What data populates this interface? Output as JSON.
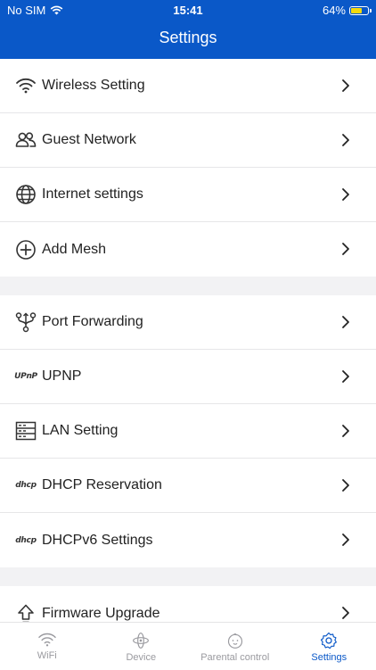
{
  "status_bar": {
    "carrier": "No SIM",
    "time": "15:41",
    "battery": "64%",
    "battery_level": 0.64
  },
  "nav": {
    "title": "Settings"
  },
  "groups": [
    {
      "items": [
        {
          "label": "Wireless Setting",
          "icon": "wifi-icon"
        },
        {
          "label": "Guest Network",
          "icon": "users-icon"
        },
        {
          "label": "Internet settings",
          "icon": "globe-icon"
        },
        {
          "label": "Add Mesh",
          "icon": "plus-circle-icon"
        }
      ]
    },
    {
      "items": [
        {
          "label": "Port Forwarding",
          "icon": "port-forwarding-icon"
        },
        {
          "label": "UPNP",
          "icon": "upnp-icon",
          "icon_text": "UPnP"
        },
        {
          "label": "LAN Setting",
          "icon": "lan-server-icon"
        },
        {
          "label": "DHCP Reservation",
          "icon": "dhcp-icon",
          "icon_text": "dhcp"
        },
        {
          "label": "DHCPv6 Settings",
          "icon": "dhcpv6-icon",
          "icon_text": "dhcp"
        }
      ]
    },
    {
      "items": [
        {
          "label": "Firmware Upgrade",
          "icon": "upload-arrow-icon"
        }
      ]
    }
  ],
  "tabbar": {
    "tabs": [
      {
        "label": "WiFi",
        "icon": "wifi-icon",
        "active": false
      },
      {
        "label": "Device",
        "icon": "atom-icon",
        "active": false
      },
      {
        "label": "Parental control",
        "icon": "child-face-icon",
        "active": false
      },
      {
        "label": "Settings",
        "icon": "gear-icon",
        "active": true
      }
    ]
  },
  "colors": {
    "accent": "#0a58c8",
    "inactive": "#9a9a9f",
    "battery": "#f5d90a"
  }
}
